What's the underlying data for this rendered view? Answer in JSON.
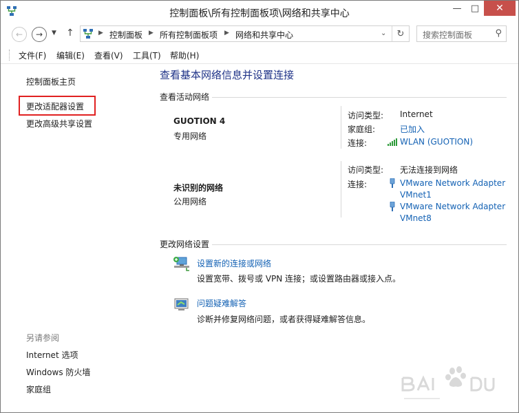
{
  "window": {
    "title": "控制面板\\所有控制面板项\\网络和共享中心",
    "controls": {
      "minimize": "—",
      "maximize": "□",
      "close": "✕"
    }
  },
  "nav": {
    "breadcrumbs": [
      "控制面板",
      "所有控制面板项",
      "网络和共享中心"
    ],
    "search_placeholder": "搜索控制面板"
  },
  "menu": [
    "文件(F)",
    "编辑(E)",
    "查看(V)",
    "工具(T)",
    "帮助(H)"
  ],
  "sidebar": {
    "links": [
      "控制面板主页",
      "更改适配器设置",
      "更改高级共享设置"
    ],
    "see_also_heading": "另请参阅",
    "see_also": [
      "Internet 选项",
      "Windows 防火墙",
      "家庭组"
    ]
  },
  "main": {
    "title": "查看基本网络信息并设置连接",
    "active_networks_heading": "查看活动网络",
    "networks": [
      {
        "name": "GUOTION  4",
        "type": "专用网络",
        "access_label": "访问类型:",
        "access_value": "Internet",
        "homegroup_label": "家庭组:",
        "homegroup_value": "已加入",
        "connection_label": "连接:",
        "connection_value": "WLAN (GUOTION)"
      },
      {
        "name": "未识别的网络",
        "type": "公用网络",
        "access_label": "访问类型:",
        "access_value": "无法连接到网络",
        "connection_label": "连接:",
        "connections": [
          {
            "line1": "VMware Network Adapter",
            "line2": "VMnet1"
          },
          {
            "line1": "VMware Network Adapter",
            "line2": "VMnet8"
          }
        ]
      }
    ],
    "change_settings_heading": "更改网络设置",
    "tasks": [
      {
        "link": "设置新的连接或网络",
        "desc": "设置宽带、拨号或 VPN 连接；或设置路由器或接入点。"
      },
      {
        "link": "问题疑难解答",
        "desc": "诊断并修复网络问题，或者获得疑难解答信息。"
      }
    ]
  },
  "colors": {
    "link": "#1462b4",
    "title": "#1e3287",
    "highlight_box": "#e02020",
    "close_button": "#c7504b"
  },
  "icons": [
    "app-network-icon",
    "back-arrow-icon",
    "forward-arrow-icon",
    "up-arrow-icon",
    "refresh-icon",
    "search-icon",
    "wifi-signal-icon",
    "ethernet-adapter-icon",
    "new-connection-icon",
    "troubleshoot-icon"
  ]
}
